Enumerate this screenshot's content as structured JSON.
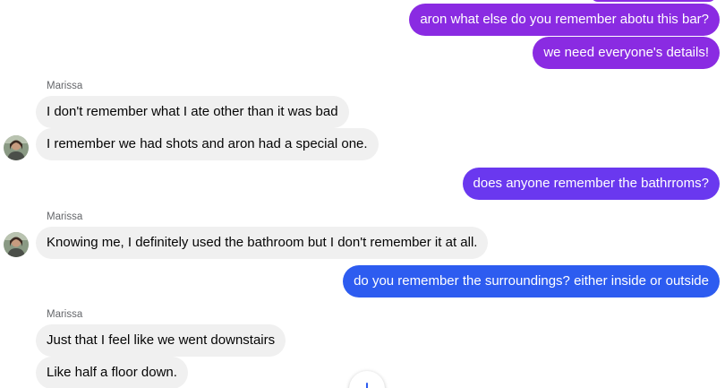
{
  "colors": {
    "outgoing_purple": "#8a2be2",
    "outgoing_violet": "#6a38ef",
    "outgoing_blue": "#2d5cf0",
    "incoming_bg": "#f0f0f0"
  },
  "messages": {
    "out1": "aron what else do you remember abotu this bar?",
    "out2": "we need everyone's details!",
    "sender1": "Marissa",
    "in1": "I don't remember what I ate other than it was bad",
    "in2": "I remember we had shots and aron had a special one.",
    "out3": "does anyone remember the bathrroms?",
    "sender2": "Marissa",
    "in3": "Knowing me, I definitely used the bathroom but I don't remember it at all.",
    "out4": "do you remember the surroundings? either inside or outside",
    "sender3": "Marissa",
    "in4": "Just that I feel like we went downstairs",
    "in5": "Like half a floor down."
  },
  "icons": {
    "avatar": "avatar-photo",
    "scroll": "scroll-to-bottom-icon"
  }
}
